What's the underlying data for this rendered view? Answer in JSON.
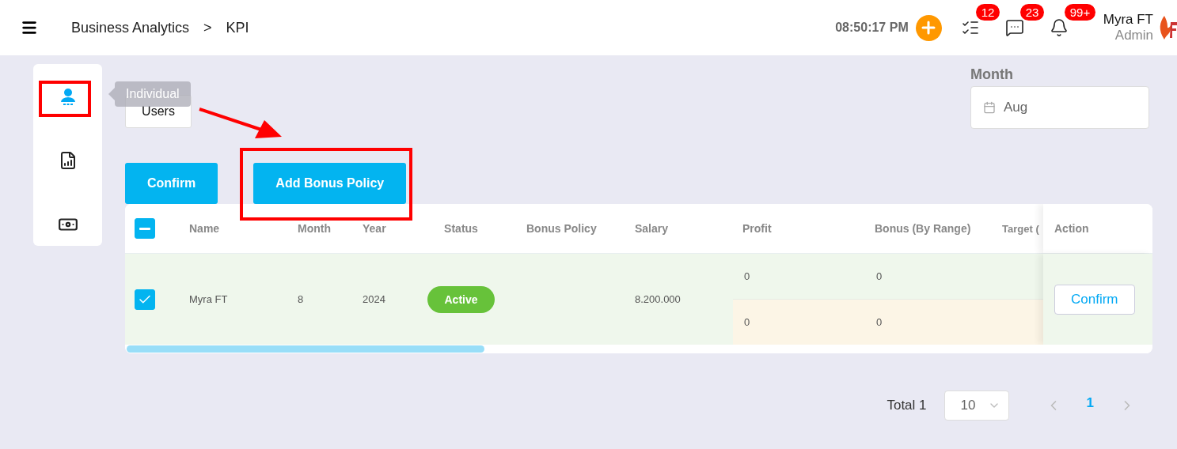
{
  "header": {
    "breadcrumb": [
      "Business Analytics",
      "KPI"
    ],
    "separator": ">",
    "time": "08:50:17 PM",
    "notifications": [
      {
        "kind": "tasks",
        "count": "12"
      },
      {
        "kind": "messages",
        "count": "23"
      },
      {
        "kind": "alerts",
        "count": "99+"
      }
    ],
    "user": {
      "name": "Myra FT",
      "role": "Admin"
    }
  },
  "sidebar": {
    "items": [
      {
        "kind": "user",
        "selected": true
      },
      {
        "kind": "report",
        "selected": false
      },
      {
        "kind": "money",
        "selected": false
      }
    ]
  },
  "tooltip": "Individual",
  "users_button": "Users",
  "month_filter": {
    "label": "Month",
    "value": "Aug"
  },
  "actions": [
    "Confirm",
    "Add Bonus Policy"
  ],
  "table": {
    "header_checkbox": {
      "indeterminate": true
    },
    "columns": [
      "Name",
      "Month",
      "Year",
      "Status",
      "Bonus Policy",
      "Salary",
      "Profit",
      "Bonus (By Range)",
      "Target (",
      "Action"
    ],
    "rows": [
      {
        "checked": true,
        "name": "Myra FT",
        "month": "8",
        "year": "2024",
        "status": {
          "kind": "active",
          "label": "Active"
        },
        "salary": "8.200.000",
        "profit": [
          "0",
          "0"
        ],
        "bonus": [
          "0",
          "0"
        ],
        "action": "Confirm"
      }
    ]
  },
  "pagination": {
    "total": "Total 1",
    "page_size": "10",
    "pages": [
      {
        "label": "1",
        "selected": true
      }
    ]
  },
  "annotations": [
    {
      "kind": "frame"
    },
    {
      "kind": "frame"
    },
    {
      "kind": "arrow"
    }
  ]
}
